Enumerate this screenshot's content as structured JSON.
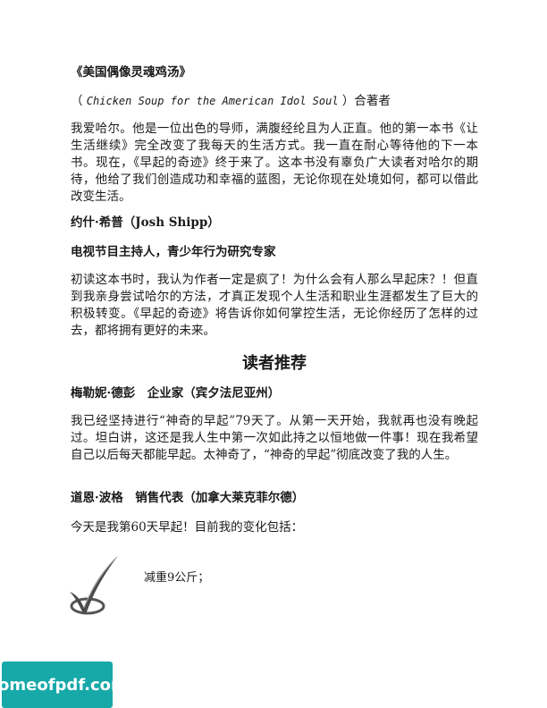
{
  "book_title": "《美国偶像灵魂鸡汤》",
  "book_subtitle": {
    "open": "（",
    "en_title": "Chicken Soup for the American Idol Soul",
    "close": "）合著者"
  },
  "para1": "我爱哈尔。他是一位出色的导师，满腹经纶且为人正直。他的第一本书《让生活继续》完全改变了我每天的生活方式。我一直在耐心等待他的下一本书。现在，《早起的奇迹》终于来了。这本书没有辜负广大读者对哈尔的期待，他给了我们创造成功和幸福的蓝图，无论你现在处境如何，都可以借此改变生活。",
  "name2": "约什·希普（Josh Shipp）",
  "role2": "电视节目主持人，青少年行为研究专家",
  "para2": "初读这本书时，我认为作者一定是疯了！为什么会有人那么早起床？！但直到我亲身尝试哈尔的方法，才真正发现个人生活和职业生涯都发生了巨大的积极转变。《早起的奇迹》将告诉你如何掌控生活，无论你经历了怎样的过去，都将拥有更好的未来。",
  "section_heading": "读者推荐",
  "reader1": "梅勒妮·德彭　企业家（宾夕法尼亚州）",
  "para3": "我已经坚持进行“神奇的早起”79天了。从第一天开始，我就再也没有晚起过。坦白讲，这还是我人生中第一次如此持之以恒地做一件事！现在我希望自己以后每天都能早起。太神奇了，“神奇的早起”彻底改变了我的人生。",
  "reader2": "道恩·波格　销售代表（加拿大莱克菲尔德）",
  "para4": "今天是我第60天早起！目前我的变化包括：",
  "check_item": "减重9公斤；",
  "watermark": "homeofpdf.com"
}
